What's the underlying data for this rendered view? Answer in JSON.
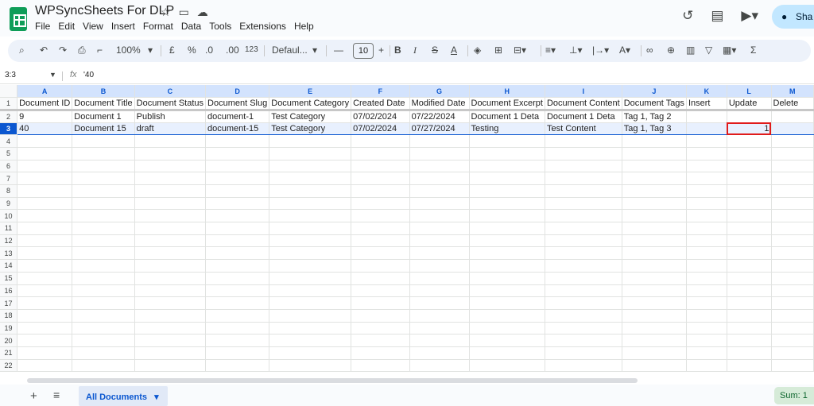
{
  "app": {
    "title": "WPSyncSheets For DLP",
    "menus": [
      "File",
      "Edit",
      "View",
      "Insert",
      "Format",
      "Data",
      "Tools",
      "Extensions",
      "Help"
    ],
    "share_label": "Sha"
  },
  "toolbar": {
    "zoom": "100%",
    "currency": "£",
    "percent": "%",
    "dec_decrease": ".0",
    "dec_increase": ".00",
    "format_num": "123",
    "font": "Defaul...",
    "font_size": "10"
  },
  "formula_bar": {
    "cell_ref": "3:3",
    "fx": "fx",
    "value": "'40"
  },
  "grid": {
    "columns": [
      "A",
      "B",
      "C",
      "D",
      "E",
      "F",
      "G",
      "H",
      "I",
      "J",
      "K",
      "L",
      "M"
    ],
    "row_count": 22,
    "rows": [
      [
        "Document ID",
        "Document Title",
        "Document Status",
        "Document Slug",
        "Document Category",
        "Created Date",
        "Modified Date",
        "Document Excerpt",
        "Document Content",
        "Document Tags",
        "Insert",
        "Update",
        "Delete"
      ],
      [
        "9",
        "Document 1",
        "Publish",
        "document-1",
        "Test Category",
        "07/02/2024",
        "07/22/2024",
        "Document 1 Deta",
        "Document 1 Deta",
        "Tag 1, Tag 2",
        "",
        "",
        ""
      ],
      [
        "40",
        "Document 15",
        "draft",
        "document-15",
        "Test Category",
        "07/02/2024",
        "07/27/2024",
        "Testing",
        "Test Content",
        "Tag 1, Tag 3",
        "",
        "1",
        ""
      ]
    ],
    "selected_row": 3,
    "highlighted_cell": "L3"
  },
  "bottom": {
    "sheet_tab": "All Documents",
    "sum": "Sum: 1"
  },
  "colors": {
    "accent": "#0b57d0",
    "sheets_green": "#0f9d58",
    "highlight_red": "#e01b1b",
    "share_bg": "#c2e7ff"
  }
}
